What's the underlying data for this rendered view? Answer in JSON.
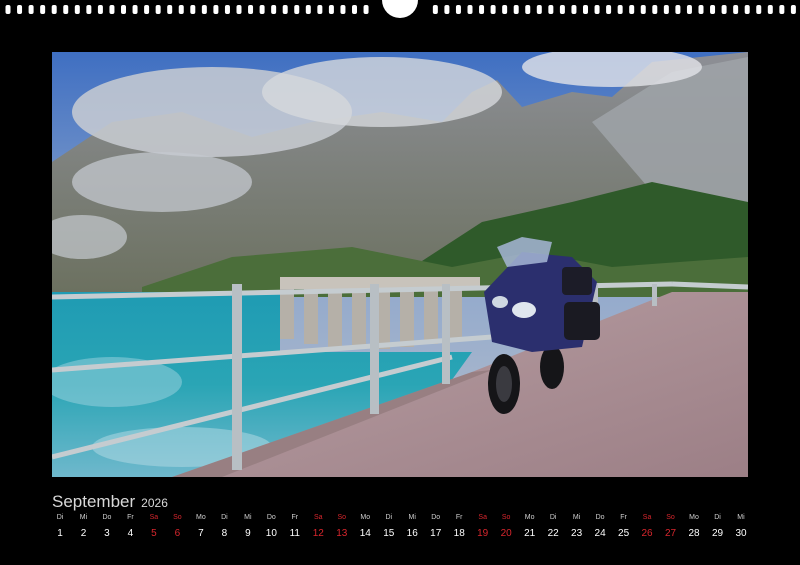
{
  "calendar": {
    "month": "September",
    "year": "2026",
    "days": [
      {
        "dn": "Di",
        "d": "1",
        "we": false
      },
      {
        "dn": "Mi",
        "d": "2",
        "we": false
      },
      {
        "dn": "Do",
        "d": "3",
        "we": false
      },
      {
        "dn": "Fr",
        "d": "4",
        "we": false
      },
      {
        "dn": "Sa",
        "d": "5",
        "we": true
      },
      {
        "dn": "So",
        "d": "6",
        "we": true
      },
      {
        "dn": "Mo",
        "d": "7",
        "we": false
      },
      {
        "dn": "Di",
        "d": "8",
        "we": false
      },
      {
        "dn": "Mi",
        "d": "9",
        "we": false
      },
      {
        "dn": "Do",
        "d": "10",
        "we": false
      },
      {
        "dn": "Fr",
        "d": "11",
        "we": false
      },
      {
        "dn": "Sa",
        "d": "12",
        "we": true
      },
      {
        "dn": "So",
        "d": "13",
        "we": true
      },
      {
        "dn": "Mo",
        "d": "14",
        "we": false
      },
      {
        "dn": "Di",
        "d": "15",
        "we": false
      },
      {
        "dn": "Mi",
        "d": "16",
        "we": false
      },
      {
        "dn": "Do",
        "d": "17",
        "we": false
      },
      {
        "dn": "Fr",
        "d": "18",
        "we": false
      },
      {
        "dn": "Sa",
        "d": "19",
        "we": true
      },
      {
        "dn": "So",
        "d": "20",
        "we": true
      },
      {
        "dn": "Mo",
        "d": "21",
        "we": false
      },
      {
        "dn": "Di",
        "d": "22",
        "we": false
      },
      {
        "dn": "Mi",
        "d": "23",
        "we": false
      },
      {
        "dn": "Do",
        "d": "24",
        "we": false
      },
      {
        "dn": "Fr",
        "d": "25",
        "we": false
      },
      {
        "dn": "Sa",
        "d": "26",
        "we": true
      },
      {
        "dn": "So",
        "d": "27",
        "we": true
      },
      {
        "dn": "Mo",
        "d": "28",
        "we": false
      },
      {
        "dn": "Di",
        "d": "29",
        "we": false
      },
      {
        "dn": "Mi",
        "d": "30",
        "we": false
      }
    ]
  },
  "colors": {
    "background": "#000000",
    "weekend": "#d8262d",
    "weekday": "#ffffff"
  }
}
